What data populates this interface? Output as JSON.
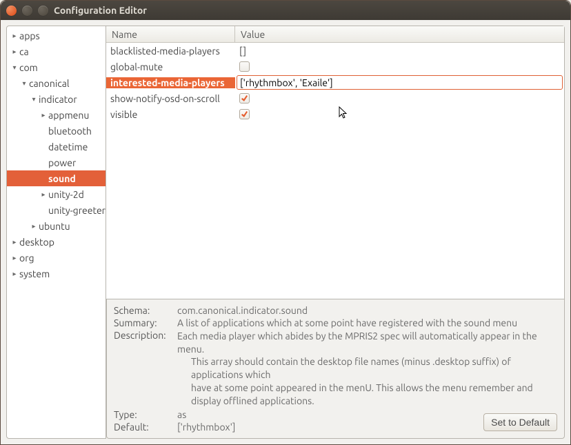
{
  "window": {
    "title": "Configuration Editor"
  },
  "tree": [
    {
      "label": "apps",
      "depth": 0,
      "arrow": "right"
    },
    {
      "label": "ca",
      "depth": 0,
      "arrow": "right"
    },
    {
      "label": "com",
      "depth": 0,
      "arrow": "down"
    },
    {
      "label": "canonical",
      "depth": 1,
      "arrow": "down"
    },
    {
      "label": "indicator",
      "depth": 2,
      "arrow": "down"
    },
    {
      "label": "appmenu",
      "depth": 3,
      "arrow": "right"
    },
    {
      "label": "bluetooth",
      "depth": 3,
      "arrow": "none"
    },
    {
      "label": "datetime",
      "depth": 3,
      "arrow": "none"
    },
    {
      "label": "power",
      "depth": 3,
      "arrow": "none"
    },
    {
      "label": "sound",
      "depth": 3,
      "arrow": "none",
      "selected": true
    },
    {
      "label": "unity-2d",
      "depth": 3,
      "arrow": "right"
    },
    {
      "label": "unity-greeter",
      "depth": 3,
      "arrow": "none"
    },
    {
      "label": "ubuntu",
      "depth": 2,
      "arrow": "right"
    },
    {
      "label": "desktop",
      "depth": 0,
      "arrow": "right"
    },
    {
      "label": "org",
      "depth": 0,
      "arrow": "right"
    },
    {
      "label": "system",
      "depth": 0,
      "arrow": "right"
    }
  ],
  "columns": {
    "name": "Name",
    "value": "Value"
  },
  "rows": [
    {
      "name": "blacklisted-media-players",
      "type": "text",
      "value": "[]"
    },
    {
      "name": "global-mute",
      "type": "check",
      "checked": false
    },
    {
      "name": "interested-media-players",
      "type": "edit",
      "value": "['rhythmbox', 'Exaile']",
      "selected": true
    },
    {
      "name": "show-notify-osd-on-scroll",
      "type": "check",
      "checked": true
    },
    {
      "name": "visible",
      "type": "check",
      "checked": true
    }
  ],
  "details": {
    "schema_label": "Schema:",
    "schema": "com.canonical.indicator.sound",
    "summary_label": "Summary:",
    "summary": "A list of applications which at some point have registered with the sound menu",
    "description_label": "Description:",
    "description_line1": "Each media player which abides by the MPRIS2 spec will automatically appear in the menu.",
    "description_line2": "This array should contain the desktop file names (minus .desktop suffix) of applications which",
    "description_line3": "have at some point appeared in the menU. This allows the menu remember and display offlined applications.",
    "type_label": "Type:",
    "type": "as",
    "default_label": "Default:",
    "default": "['rhythmbox']",
    "set_default_button": "Set to Default"
  }
}
